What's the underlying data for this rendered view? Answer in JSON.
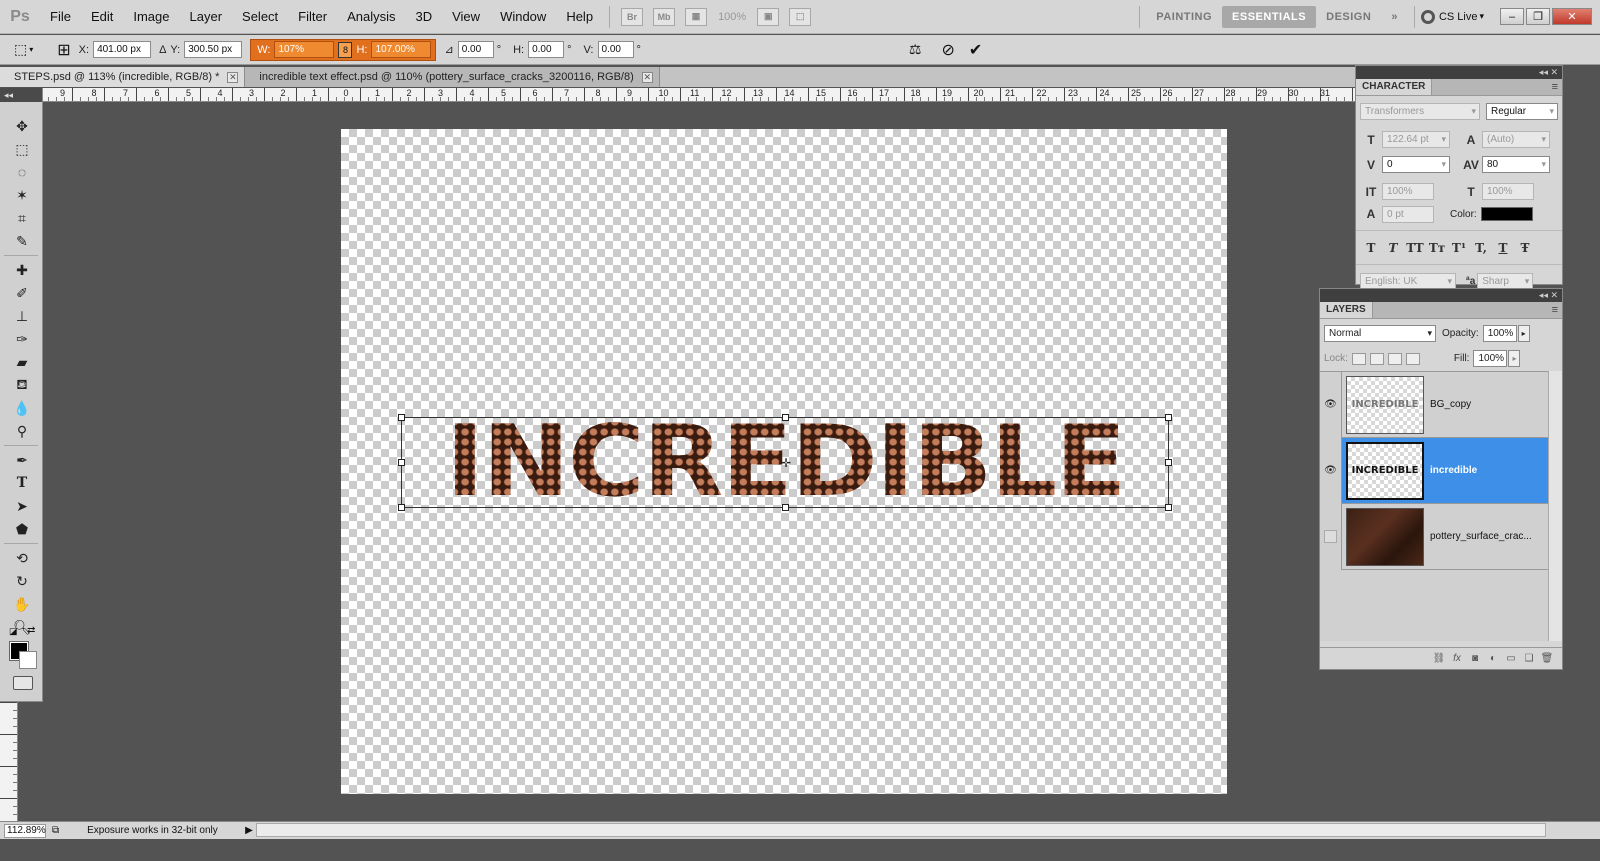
{
  "app": {
    "logo": "Ps"
  },
  "menu": {
    "items": [
      "File",
      "Edit",
      "Image",
      "Layer",
      "Select",
      "Filter",
      "Analysis",
      "3D",
      "View",
      "Window",
      "Help"
    ]
  },
  "menubar_extras": {
    "bridge_icon": "Br",
    "minibridge_icon": "Mb",
    "zoom": "100%",
    "workspaces": [
      "PAINTING",
      "ESSENTIALS",
      "DESIGN"
    ],
    "active_workspace": "ESSENTIALS",
    "more": "»",
    "cs_live": "CS Live"
  },
  "options": {
    "x_label": "X:",
    "x_value": "401.00 px",
    "y_label": "Y:",
    "y_value": "300.50 px",
    "w_label": "W:",
    "w_value": "107%",
    "h_label": "H:",
    "h_value": "107.00%",
    "angle_value": "0.00",
    "angle_unit": "°",
    "hskew_label": "H:",
    "hskew_value": "0.00",
    "hskew_unit": "°",
    "vskew_label": "V:",
    "vskew_value": "0.00",
    "vskew_unit": "°"
  },
  "tabs": [
    {
      "label": "STEPS.psd @ 113% (incredible, RGB/8) *",
      "active": true
    },
    {
      "label": "incredible text effect.psd @ 110% (pottery_surface_cracks_3200116, RGB/8)",
      "active": false
    }
  ],
  "ruler": {
    "ticks": [
      "9",
      "8",
      "7",
      "6",
      "5",
      "4",
      "3",
      "2",
      "1",
      "0",
      "1",
      "2",
      "3",
      "4",
      "5",
      "6",
      "7",
      "8",
      "9",
      "10",
      "11",
      "12",
      "13",
      "14",
      "15",
      "16",
      "17",
      "18",
      "19",
      "20",
      "21",
      "22",
      "23",
      "24",
      "25",
      "26",
      "27",
      "28",
      "29",
      "30",
      "31"
    ]
  },
  "canvas": {
    "text": "INCREDIBLE"
  },
  "character": {
    "tab": "CHARACTER",
    "font_family": "Transformers",
    "font_style": "Regular",
    "size": "122.64 pt",
    "leading": "(Auto)",
    "kerning": "0",
    "tracking": "80",
    "vscale": "100%",
    "hscale": "100%",
    "baseline": "0 pt",
    "color_label": "Color:",
    "color": "#000000",
    "language": "English: UK",
    "aa_label": "a",
    "antialias": "Sharp",
    "format_buttons": [
      "T",
      "T",
      "TT",
      "Tт",
      "T¹",
      "T,",
      "T",
      "Ŧ"
    ]
  },
  "layers": {
    "tab": "LAYERS",
    "blend_mode": "Normal",
    "opacity_label": "Opacity:",
    "opacity": "100%",
    "lock_label": "Lock:",
    "fill_label": "Fill:",
    "fill": "100%",
    "items": [
      {
        "name": "BG_copy",
        "thumb_text": "INCREDIBLE",
        "visible": true,
        "selected": false
      },
      {
        "name": "incredible",
        "thumb_text": "INCREDIBLE",
        "visible": true,
        "selected": true
      },
      {
        "name": "pottery_surface_crac...",
        "thumb_text": "",
        "visible": false,
        "selected": false
      }
    ]
  },
  "status": {
    "zoom": "112.89%",
    "info": "Exposure works in 32-bit only"
  }
}
